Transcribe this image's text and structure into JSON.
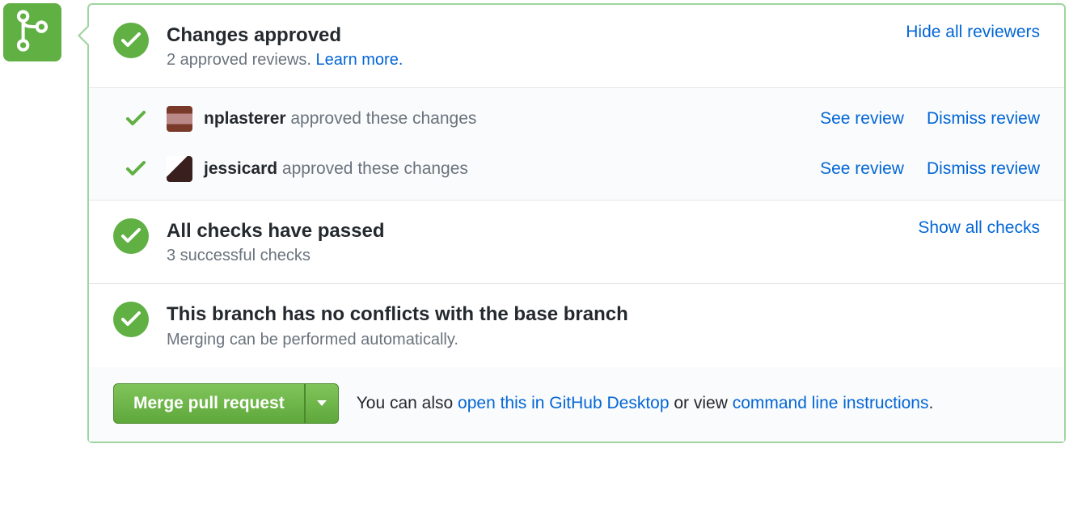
{
  "approval": {
    "title": "Changes approved",
    "subtitle_prefix": "2 approved reviews. ",
    "learn_more": "Learn more.",
    "hide_link": "Hide all reviewers"
  },
  "reviewers": [
    {
      "username": "nplasterer",
      "action_text": " approved these changes",
      "see": "See review",
      "dismiss": "Dismiss review"
    },
    {
      "username": "jessicard",
      "action_text": " approved these changes",
      "see": "See review",
      "dismiss": "Dismiss review"
    }
  ],
  "checks": {
    "title": "All checks have passed",
    "subtitle": "3 successful checks",
    "show_link": "Show all checks"
  },
  "conflicts": {
    "title": "This branch has no conflicts with the base branch",
    "subtitle": "Merging can be performed automatically."
  },
  "merge": {
    "button_label": "Merge pull request",
    "footer_prefix": "You can also ",
    "desktop_link": "open this in GitHub Desktop",
    "footer_mid": " or view ",
    "cli_link": "command line instructions",
    "footer_suffix": "."
  }
}
